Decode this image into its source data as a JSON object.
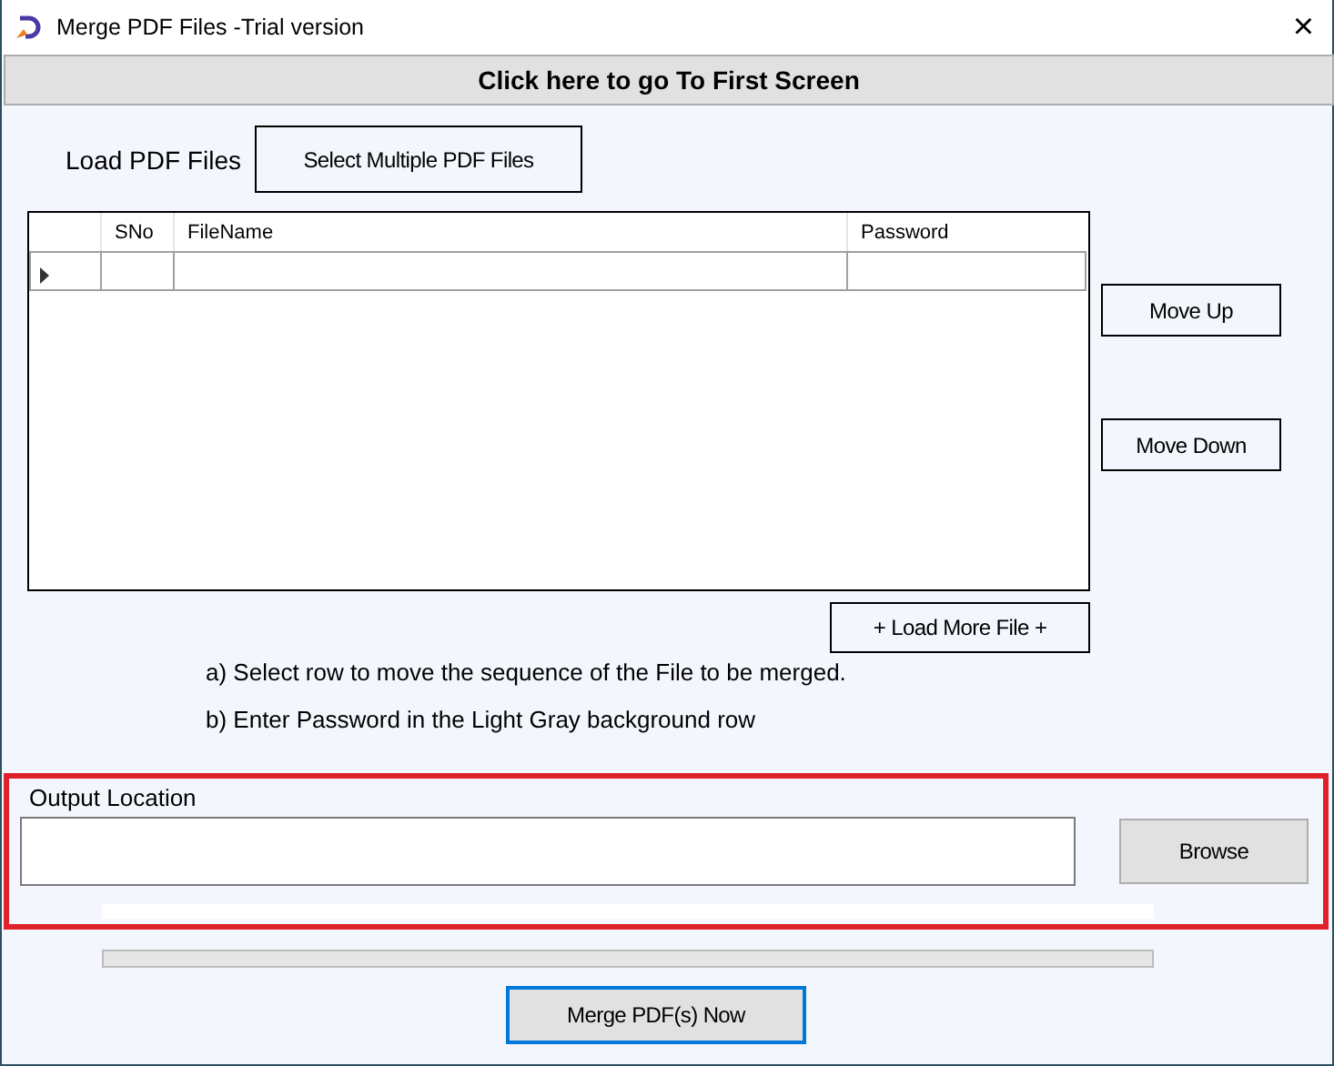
{
  "window": {
    "title": "Merge PDF Files -Trial version",
    "close": "×"
  },
  "first_screen_button": "Click here to go To First Screen",
  "load": {
    "label": "Load PDF Files",
    "button": "Select Multiple PDF Files"
  },
  "table": {
    "columns": [
      "SNo",
      "FileName",
      "Password"
    ],
    "rows": [
      {
        "current": true
      }
    ]
  },
  "move_buttons": [
    "Move Up",
    "Move Down"
  ],
  "load_more_button": "+ Load More File +",
  "notes": [
    "a) Select row to move the sequence of the File to be merged.",
    "b) Enter Password in the Light Gray background row"
  ],
  "output": {
    "label": "Output Location",
    "highlighted": true,
    "browse_button": "Browse"
  },
  "progress": {
    "level": 0
  },
  "merge_button": {
    "label": "Merge  PDF(s) Now",
    "focused": true
  }
}
